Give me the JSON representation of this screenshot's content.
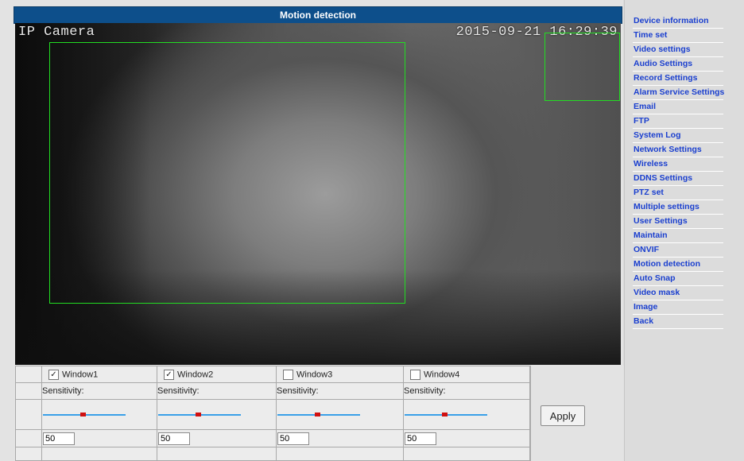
{
  "title": "Motion detection",
  "video": {
    "osd_name": "IP Camera",
    "osd_time": "2015-09-21 16:29:39"
  },
  "windows": [
    {
      "label": "Window1",
      "checked": true,
      "sensitivity_label": "Sensitivity:",
      "slider_level": 0.5,
      "value": "50"
    },
    {
      "label": "Window2",
      "checked": true,
      "sensitivity_label": "Sensitivity:",
      "slider_level": 0.5,
      "value": "50"
    },
    {
      "label": "Window3",
      "checked": false,
      "sensitivity_label": "Sensitivity:",
      "slider_level": 0.5,
      "value": "50"
    },
    {
      "label": "Window4",
      "checked": false,
      "sensitivity_label": "Sensitivity:",
      "slider_level": 0.5,
      "value": "50"
    }
  ],
  "apply_label": "Apply",
  "colors": {
    "title_bar": "#0d4f8b",
    "zone_outline": "#22dd22",
    "slider_track": "#3aa0e8",
    "slider_knob": "#d01010",
    "nav_link": "#1a3fcf"
  },
  "nav": [
    "Device information",
    "Time set",
    "Video settings",
    "Audio Settings",
    "Record Settings",
    "Alarm Service Settings",
    "Email",
    "FTP",
    "System Log",
    "Network Settings",
    "Wireless",
    "DDNS Settings",
    "PTZ set",
    "Multiple settings",
    "User Settings",
    "Maintain",
    "ONVIF",
    "Motion detection",
    "Auto Snap",
    "Video mask",
    "Image",
    "Back"
  ]
}
